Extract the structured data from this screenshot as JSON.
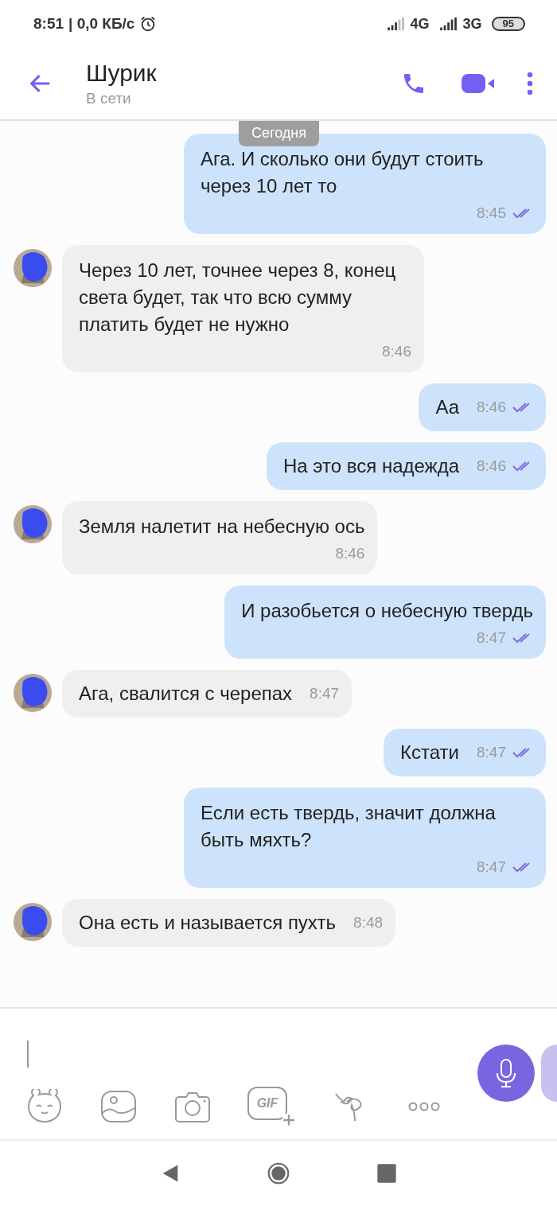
{
  "status_bar": {
    "time": "8:51",
    "speed": "| 0,0 КБ/с",
    "network_1": "4G",
    "network_2": "3G",
    "battery": "95"
  },
  "header": {
    "name": "Шурик",
    "status": "В сети"
  },
  "date_label": "Сегодня",
  "messages": [
    {
      "kind": "out",
      "text": "Ага. И сколько они будут стоить через 10 лет то",
      "time": "8:45",
      "time_below": true,
      "read": true
    },
    {
      "kind": "in",
      "text": "Через 10 лет, точнее через 8, конец света будет, так что всю сумму платить будет не нужно",
      "time": "8:46",
      "time_below": true,
      "avatar": true
    },
    {
      "kind": "out",
      "text": "Аа",
      "time": "8:46",
      "time_below": false,
      "read": true
    },
    {
      "kind": "out",
      "text": "На это вся надежда",
      "time": "8:46",
      "time_below": false,
      "read": true
    },
    {
      "kind": "in",
      "text": "Земля налетит на небесную ось",
      "time": "8:46",
      "time_below": true,
      "avatar": true
    },
    {
      "kind": "out",
      "text": "И разобьется о небесную твердь",
      "time": "8:47",
      "time_below": true,
      "read": true
    },
    {
      "kind": "in",
      "text": "Ага, свалится с черепах",
      "time": "8:47",
      "time_below": false,
      "avatar": true
    },
    {
      "kind": "out",
      "text": "Кстати",
      "time": "8:47",
      "time_below": false,
      "read": true
    },
    {
      "kind": "out",
      "text": "Если есть твердь, значит должна быть мяхть?",
      "time": "8:47",
      "time_below": true,
      "read": true
    },
    {
      "kind": "in",
      "text": "Она есть и называется пухть",
      "time": "8:48",
      "time_below": false,
      "avatar": true
    }
  ],
  "composer": {
    "gif_label": "GIF"
  }
}
